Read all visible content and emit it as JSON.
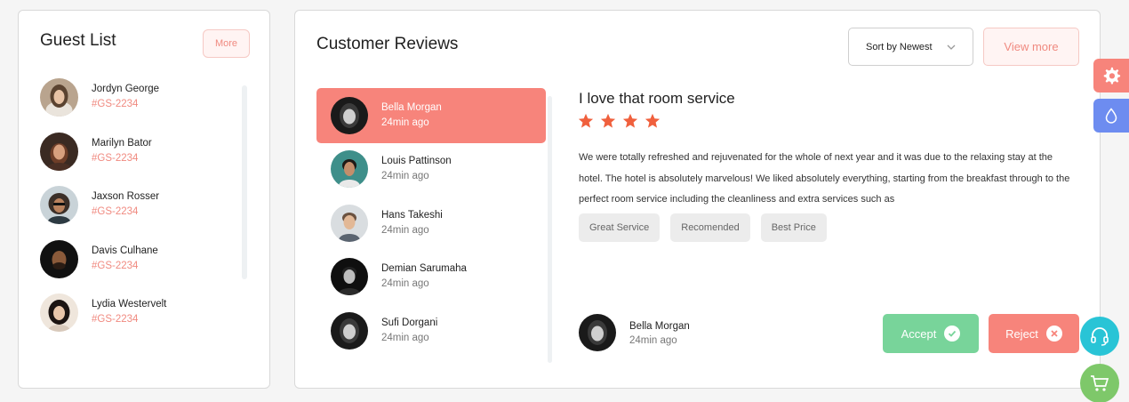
{
  "guest_list": {
    "title": "Guest List",
    "more_label": "More",
    "guests": [
      {
        "name": "Jordyn George",
        "id": "#GS-2234"
      },
      {
        "name": "Marilyn Bator",
        "id": "#GS-2234"
      },
      {
        "name": "Jaxson Rosser",
        "id": "#GS-2234"
      },
      {
        "name": "Davis Culhane",
        "id": "#GS-2234"
      },
      {
        "name": "Lydia Westervelt",
        "id": "#GS-2234"
      }
    ]
  },
  "reviews": {
    "title": "Customer Reviews",
    "sort_label": "Sort by Newest",
    "view_more_label": "View more",
    "reviewers": [
      {
        "name": "Bella Morgan",
        "time": "24min ago",
        "active": true
      },
      {
        "name": "Louis Pattinson",
        "time": "24min ago",
        "active": false
      },
      {
        "name": "Hans Takeshi",
        "time": "24min ago",
        "active": false
      },
      {
        "name": "Demian Sarumaha",
        "time": "24min ago",
        "active": false
      },
      {
        "name": "Sufi Dorgani",
        "time": "24min ago",
        "active": false
      }
    ],
    "selected": {
      "title": "I love that room service",
      "rating": 4,
      "body": "We were totally refreshed and rejuvenated for the whole of next year and it was due to the relaxing stay at the hotel. The hotel is absolutely marvelous! We liked absolutely everything, starting from the breakfast through to the perfect room service including the cleanliness and extra services such as",
      "tags": [
        "Great Service",
        "Recomended",
        "Best Price"
      ],
      "author": {
        "name": "Bella Morgan",
        "time": "24min ago"
      },
      "accept_label": "Accept",
      "reject_label": "Reject"
    }
  },
  "colors": {
    "accent": "#f7847b",
    "accept": "#78d49a",
    "star": "#f0603d",
    "theme_tab": "#6d8cf0",
    "support": "#29c4d6",
    "cart": "#7ec86a"
  },
  "side_widgets": [
    "gear-icon",
    "droplet-icon",
    "headset-icon",
    "cart-icon"
  ]
}
